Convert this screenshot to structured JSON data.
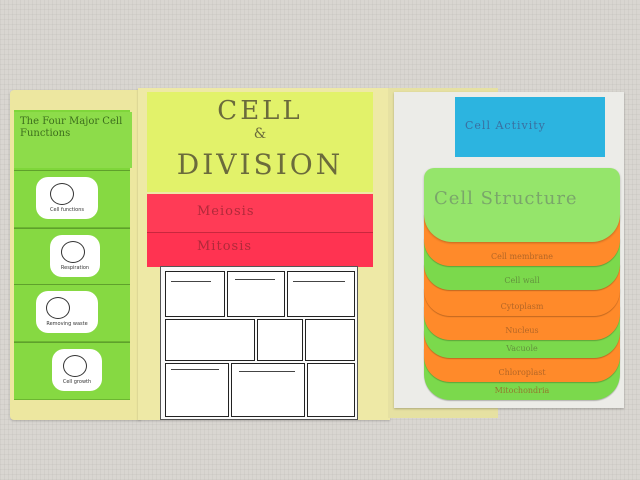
{
  "left_panel": {
    "title": "The Four Major Cell Functions",
    "flaps": [
      {
        "caption": "Cell functions"
      },
      {
        "caption": "Respiration"
      },
      {
        "caption": "Removing waste"
      },
      {
        "caption": "Cell growth"
      }
    ]
  },
  "center_panel": {
    "title_line1": "CELL",
    "title_amp": "&",
    "title_line2": "DIVISION",
    "tabs": [
      "Meiosis",
      "Mitosis"
    ]
  },
  "right_panel": {
    "card_title": "Cell Activity",
    "top_tab": "Cell Structure",
    "tabs": [
      {
        "label": "Cell membrane",
        "color": "#ff8a2a"
      },
      {
        "label": "Cell wall",
        "color": "#7bd94c"
      },
      {
        "label": "Cytoplasm",
        "color": "#ff8a2a"
      },
      {
        "label": "Nucleus",
        "color": "#ff8a2a"
      },
      {
        "label": "Vacuole",
        "color": "#7bd94c"
      },
      {
        "label": "Chloroplast",
        "color": "#ff8a2a"
      },
      {
        "label": "Mitochondria",
        "color": "#7bd94c"
      }
    ]
  },
  "colors": {
    "folder": "#eee9a6",
    "green_paper": "#7fd63a",
    "yellow_paper": "#e2f26a",
    "pink_paper": "#ff3b56",
    "blue_paper": "#2cb4e0",
    "orange_paper": "#ff8a2a"
  }
}
